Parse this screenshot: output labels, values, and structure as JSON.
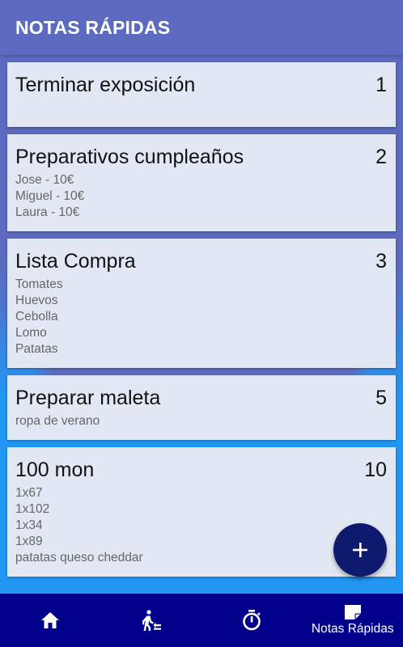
{
  "appbar": {
    "title": "NOTAS RÁPIDAS"
  },
  "notes": [
    {
      "title": "Terminar exposición",
      "number": "1",
      "lines": []
    },
    {
      "title": "Preparativos cumpleaños",
      "number": "2",
      "lines": [
        "Jose - 10€",
        "Miguel - 10€",
        "Laura - 10€"
      ]
    },
    {
      "title": "Lista Compra",
      "number": "3",
      "lines": [
        "Tomates",
        "Huevos",
        "Cebolla",
        "Lomo",
        "Patatas"
      ]
    },
    {
      "title": "Preparar maleta",
      "number": "5",
      "lines": [
        "ropa de verano"
      ]
    },
    {
      "title": "100 mon",
      "number": "10",
      "lines": [
        "1x67",
        "1x102",
        "1x34",
        "1x89",
        "patatas queso cheddar"
      ]
    }
  ],
  "fab": {
    "icon": "plus-icon"
  },
  "bottom_nav": [
    {
      "icon": "home-icon",
      "label": ""
    },
    {
      "icon": "exercise-icon",
      "label": ""
    },
    {
      "icon": "timer-icon",
      "label": ""
    },
    {
      "icon": "note-icon",
      "label": "Notas Rápidas",
      "active": true
    }
  ],
  "colors": {
    "appbar": "#5c6bc0",
    "card": "#e2e8f3",
    "fab": "#0d1a6e",
    "bottom_nav": "#00008b",
    "background": "#2196f3"
  }
}
